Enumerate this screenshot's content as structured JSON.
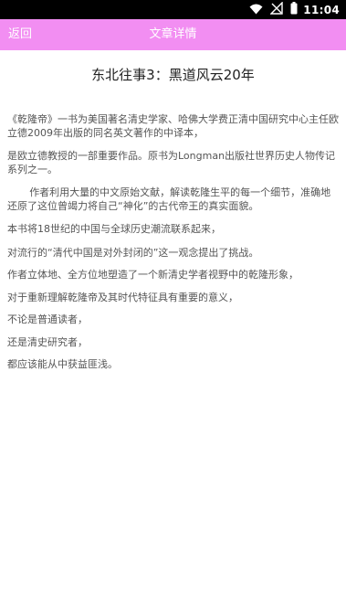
{
  "status_bar": {
    "time": "11:04",
    "icons": [
      "wifi-icon",
      "signal-no-sim-icon",
      "battery-icon"
    ]
  },
  "app_bar": {
    "back_label": "返回",
    "title": "文章详情",
    "background": "#f28ef2"
  },
  "article": {
    "title": "东北往事3：黑道风云20年",
    "paragraphs": [
      "《乾隆帝》一书为美国著名清史学家、哈佛大学费正清中国研究中心主任欧立德2009年出版的同名英文著作的中译本，",
      "是欧立德教授的一部重要作品。原书为Longman出版社世界历史人物传记系列之一。",
      "作者利用大量的中文原始文献，解读乾隆生平的每一个细节，准确地还原了这位曾竭力将自己“神化”的古代帝王的真实面貌。",
      "本书将18世纪的中国与全球历史潮流联系起来，",
      "对流行的“清代中国是对外封闭的”这一观念提出了挑战。",
      "作者立体地、全方位地塑造了一个新清史学者视野中的乾隆形象，",
      "对于重新理解乾隆帝及其时代特征具有重要的意义，",
      "不论是普通读者，",
      "还是清史研究者，",
      "都应该能从中获益匪浅。"
    ]
  }
}
